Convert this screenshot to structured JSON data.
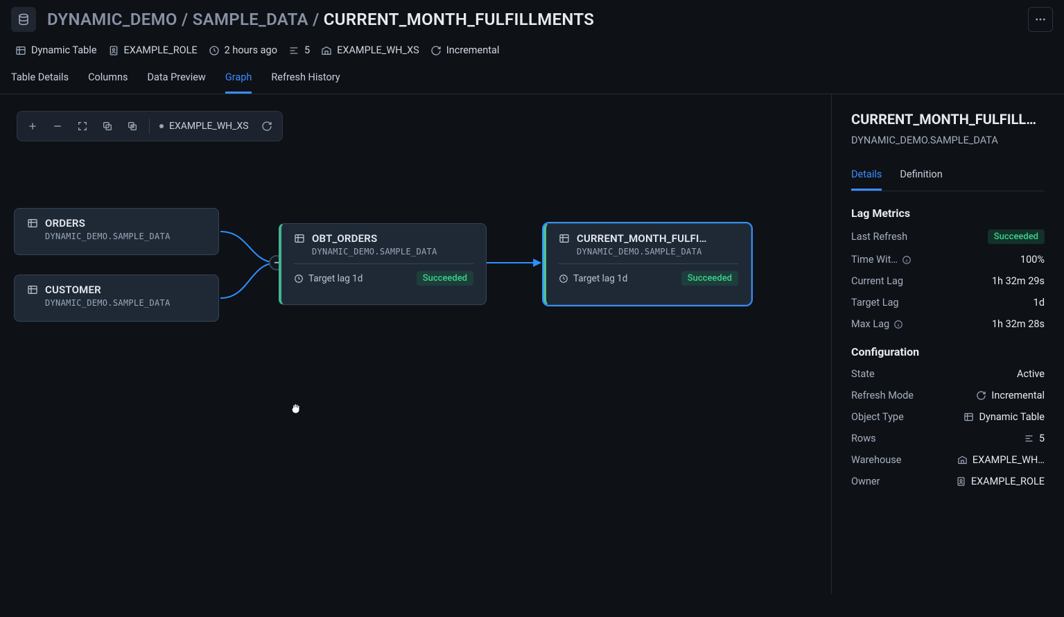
{
  "breadcrumb": {
    "seg1": "DYNAMIC_DEMO",
    "seg2": "SAMPLE_DATA",
    "seg3": "CURRENT_MONTH_FULFILLMENTS"
  },
  "meta": {
    "object_type": "Dynamic Table",
    "role": "EXAMPLE_ROLE",
    "last_refresh": "2 hours ago",
    "rows": "5",
    "warehouse": "EXAMPLE_WH_XS",
    "refresh_mode": "Incremental"
  },
  "tabs": [
    {
      "label": "Table Details",
      "active": false
    },
    {
      "label": "Columns",
      "active": false
    },
    {
      "label": "Data Preview",
      "active": false
    },
    {
      "label": "Graph",
      "active": true
    },
    {
      "label": "Refresh History",
      "active": false
    }
  ],
  "graph_toolbar": {
    "warehouse": "EXAMPLE_WH_XS"
  },
  "nodes": {
    "orders": {
      "name": "ORDERS",
      "path": "DYNAMIC_DEMO.SAMPLE_DATA"
    },
    "customer": {
      "name": "CUSTOMER",
      "path": "DYNAMIC_DEMO.SAMPLE_DATA"
    },
    "obt": {
      "name": "OBT_ORDERS",
      "path": "DYNAMIC_DEMO.SAMPLE_DATA",
      "lag": "Target lag 1d",
      "status": "Succeeded"
    },
    "cmf": {
      "name": "CURRENT_MONTH_FULFI…",
      "path": "DYNAMIC_DEMO.SAMPLE_DATA",
      "lag": "Target lag 1d",
      "status": "Succeeded"
    }
  },
  "sidepanel": {
    "title": "CURRENT_MONTH_FULFILLME…",
    "sub": "DYNAMIC_DEMO.SAMPLE_DATA",
    "tabs": [
      {
        "label": "Details",
        "active": true
      },
      {
        "label": "Definition",
        "active": false
      }
    ],
    "sections": {
      "lag_metrics": "Lag Metrics",
      "configuration": "Configuration"
    },
    "lag": {
      "last_refresh_k": "Last Refresh",
      "last_refresh_v": "Succeeded",
      "time_within_k": "Time Wit…",
      "time_within_v": "100%",
      "current_lag_k": "Current Lag",
      "current_lag_v": "1h 32m 29s",
      "target_lag_k": "Target Lag",
      "target_lag_v": "1d",
      "max_lag_k": "Max Lag",
      "max_lag_v": "1h 32m 28s"
    },
    "config": {
      "state_k": "State",
      "state_v": "Active",
      "refresh_mode_k": "Refresh Mode",
      "refresh_mode_v": "Incremental",
      "object_type_k": "Object Type",
      "object_type_v": "Dynamic Table",
      "rows_k": "Rows",
      "rows_v": "5",
      "warehouse_k": "Warehouse",
      "warehouse_v": "EXAMPLE_WH…",
      "owner_k": "Owner",
      "owner_v": "EXAMPLE_ROLE"
    }
  }
}
